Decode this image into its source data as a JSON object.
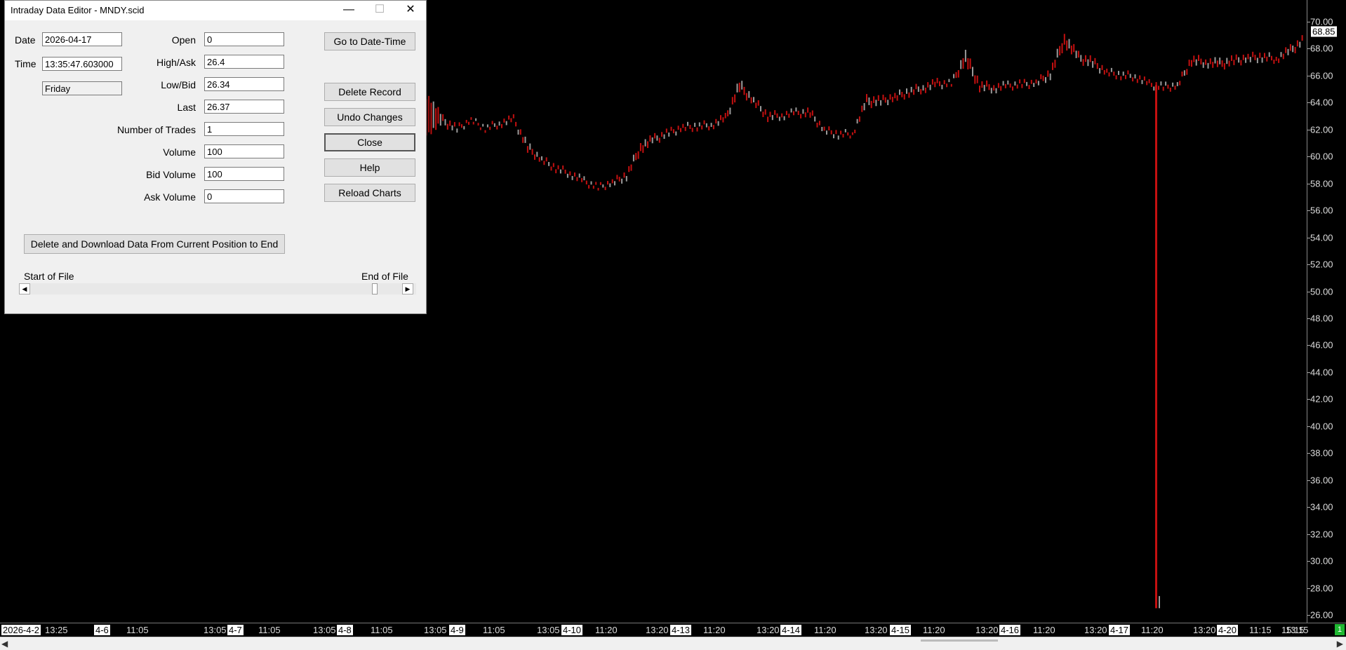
{
  "dialog": {
    "title": "Intraday Data Editor - MNDY.scid",
    "date_label": "Date",
    "date_value": "2026-04-17",
    "time_label": "Time",
    "time_value": "13:35:47.603000",
    "weekday_value": "Friday",
    "open_label": "Open",
    "open_value": "0",
    "high_label": "High/Ask",
    "high_value": "26.4",
    "low_label": "Low/Bid",
    "low_value": "26.34",
    "last_label": "Last",
    "last_value": "26.37",
    "trades_label": "Number of Trades",
    "trades_value": "1",
    "volume_label": "Volume",
    "volume_value": "100",
    "bid_volume_label": "Bid Volume",
    "bid_volume_value": "100",
    "ask_volume_label": "Ask Volume",
    "ask_volume_value": "0",
    "goto_button": "Go to Date-Time",
    "delete_record_button": "Delete  Record",
    "undo_button": "Undo Changes",
    "close_button": "Close",
    "help_button": "Help",
    "reload_button": "Reload Charts",
    "delete_download_button": "Delete and Download Data From Current Position to End",
    "start_label": "Start of File",
    "end_label": "End of File"
  },
  "chart": {
    "last_price": "68.85",
    "indicator_value": "1",
    "price_labels": [
      "70.00",
      "68.00",
      "66.00",
      "64.00",
      "62.00",
      "60.00",
      "58.00",
      "56.00",
      "54.00",
      "52.00",
      "50.00",
      "48.00",
      "46.00",
      "44.00",
      "42.00",
      "40.00",
      "38.00",
      "36.00",
      "34.00",
      "32.00",
      "30.00",
      "28.00",
      "26.00"
    ],
    "time_labels": [
      {
        "text": "2026-4-2",
        "date": true
      },
      {
        "text": "13:25",
        "date": false
      },
      {
        "text": "4-6",
        "date": true
      },
      {
        "text": "11:05",
        "date": false
      },
      {
        "text": "13:05",
        "date": false
      },
      {
        "text": "4-7",
        "date": true
      },
      {
        "text": "11:05",
        "date": false
      },
      {
        "text": "13:05",
        "date": false
      },
      {
        "text": "4-8",
        "date": true
      },
      {
        "text": "11:05",
        "date": false
      },
      {
        "text": "13:05",
        "date": false
      },
      {
        "text": "4-9",
        "date": true
      },
      {
        "text": "11:05",
        "date": false
      },
      {
        "text": "13:05",
        "date": false
      },
      {
        "text": "4-10",
        "date": true
      },
      {
        "text": "11:20",
        "date": false
      },
      {
        "text": "13:20",
        "date": false
      },
      {
        "text": "4-13",
        "date": true
      },
      {
        "text": "11:20",
        "date": false
      },
      {
        "text": "13:20",
        "date": false
      },
      {
        "text": "4-14",
        "date": true
      },
      {
        "text": "11:20",
        "date": false
      },
      {
        "text": "13:20",
        "date": false
      },
      {
        "text": "4-15",
        "date": true
      },
      {
        "text": "11:20",
        "date": false
      },
      {
        "text": "13:20",
        "date": false
      },
      {
        "text": "4-16",
        "date": true
      },
      {
        "text": "11:20",
        "date": false
      },
      {
        "text": "13:20",
        "date": false
      },
      {
        "text": "4-17",
        "date": true
      },
      {
        "text": "11:20",
        "date": false
      },
      {
        "text": "13:20",
        "date": false
      },
      {
        "text": "4-20",
        "date": true
      },
      {
        "text": "11:15",
        "date": false
      },
      {
        "text": "13:15",
        "date": false
      },
      {
        "text": "15:15",
        "date": false
      }
    ],
    "price_series": [
      [
        61.8,
        64.5
      ],
      [
        62.4,
        62.9
      ],
      [
        61.9,
        62.2
      ],
      [
        62.6,
        62.8
      ],
      [
        62.0,
        62.2
      ],
      [
        62.3,
        62.6
      ],
      [
        62.6,
        62.9
      ],
      [
        60.4,
        60.9
      ],
      [
        59.6,
        59.9
      ],
      [
        59.0,
        59.3
      ],
      [
        58.6,
        58.9
      ],
      [
        58.0,
        58.3
      ],
      [
        57.6,
        57.8
      ],
      [
        57.9,
        58.2
      ],
      [
        58.4,
        58.8
      ],
      [
        60.4,
        61.0
      ],
      [
        61.1,
        61.5
      ],
      [
        61.6,
        61.9
      ],
      [
        62.0,
        62.3
      ],
      [
        62.1,
        62.4
      ],
      [
        62.2,
        62.5
      ],
      [
        62.6,
        63.0
      ],
      [
        64.9,
        65.6
      ],
      [
        63.9,
        64.3
      ],
      [
        62.8,
        63.2
      ],
      [
        62.9,
        63.2
      ],
      [
        63.1,
        63.4
      ],
      [
        63.0,
        63.4
      ],
      [
        61.8,
        62.1
      ],
      [
        61.5,
        61.8
      ],
      [
        61.6,
        61.8
      ],
      [
        63.8,
        64.4
      ],
      [
        63.9,
        64.3
      ],
      [
        64.2,
        64.6
      ],
      [
        64.6,
        65.0
      ],
      [
        64.9,
        65.3
      ],
      [
        65.2,
        65.6
      ],
      [
        65.3,
        65.5
      ],
      [
        66.9,
        67.8
      ],
      [
        65.0,
        65.5
      ],
      [
        64.9,
        65.3
      ],
      [
        65.1,
        65.4
      ],
      [
        65.2,
        65.5
      ],
      [
        65.3,
        65.6
      ],
      [
        65.9,
        66.4
      ],
      [
        68.3,
        69.1
      ],
      [
        67.1,
        67.6
      ],
      [
        66.7,
        67.2
      ],
      [
        66.1,
        66.4
      ],
      [
        65.9,
        66.2
      ],
      [
        65.8,
        66.1
      ],
      [
        65.2,
        65.5
      ],
      [
        65.0,
        65.3
      ],
      [
        65.1,
        65.4
      ],
      [
        66.9,
        67.4
      ],
      [
        66.8,
        67.2
      ],
      [
        66.6,
        67.1
      ],
      [
        66.9,
        67.3
      ],
      [
        67.1,
        67.5
      ],
      [
        67.2,
        67.6
      ],
      [
        67.1,
        67.4
      ],
      [
        67.6,
        68.1
      ],
      [
        68.5,
        68.9
      ]
    ],
    "spike": {
      "high": 65.3,
      "low": 26.5
    }
  }
}
